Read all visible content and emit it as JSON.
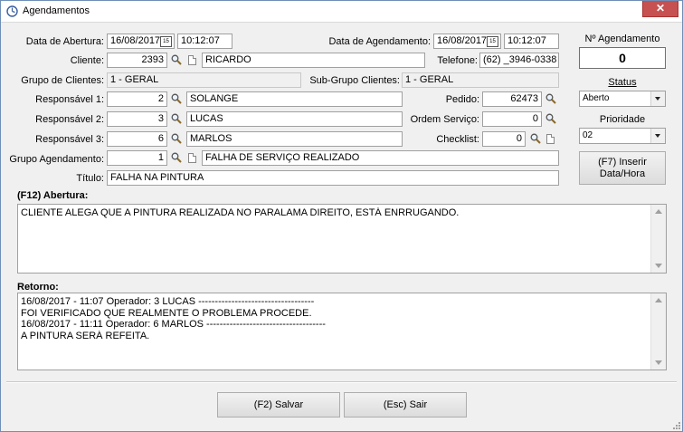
{
  "window": {
    "title": "Agendamentos",
    "close": "✕"
  },
  "form": {
    "data_abertura": {
      "label": "Data de Abertura:",
      "date": "16/08/2017",
      "time": "10:12:07"
    },
    "data_agendamento": {
      "label": "Data de Agendamento:",
      "date": "16/08/2017",
      "time": "10:12:07"
    },
    "cliente": {
      "label": "Cliente:",
      "code": "2393",
      "name": "RICARDO"
    },
    "telefone": {
      "label": "Telefone:",
      "value": "(62) _3946-0338"
    },
    "grupo_clientes": {
      "label": "Grupo de Clientes:",
      "value": "1 - GERAL"
    },
    "sub_grupo": {
      "label": "Sub-Grupo Clientes:",
      "value": "1 - GERAL"
    },
    "responsavel1": {
      "label": "Responsável 1:",
      "code": "2",
      "name": "SOLANGE"
    },
    "responsavel2": {
      "label": "Responsável 2:",
      "code": "3",
      "name": "LUCAS"
    },
    "responsavel3": {
      "label": "Responsável 3:",
      "code": "6",
      "name": "MARLOS"
    },
    "pedido": {
      "label": "Pedido:",
      "value": "62473"
    },
    "ordem_servico": {
      "label": "Ordem Serviço:",
      "value": "0"
    },
    "checklist": {
      "label": "Checklist:",
      "value": "0"
    },
    "grupo_agendamento": {
      "label": "Grupo Agendamento:",
      "code": "1",
      "name": "FALHA DE SERVIÇO REALIZADO"
    },
    "titulo": {
      "label": "Título:",
      "value": "FALHA NA PINTURA"
    }
  },
  "abertura": {
    "label": "(F12) Abertura:",
    "lines": [
      "CLIENTE ALEGA QUE A PINTURA REALIZADA NO PARALAMA DIREITO, ESTÁ ENRRUGANDO."
    ]
  },
  "retorno": {
    "label": "Retorno:",
    "lines": [
      "16/08/2017 - 11:07 Operador: 3 LUCAS -----------------------------------",
      "FOI VERIFICADO QUE REALMENTE O PROBLEMA PROCEDE.",
      "16/08/2017 - 11:11 Operador: 6 MARLOS ------------------------------------",
      "A PINTURA SERÁ REFEITA."
    ]
  },
  "side": {
    "num_agendamento_label": "Nº Agendamento",
    "num_agendamento_value": "0",
    "status_label": "Status",
    "status_value": "Aberto",
    "prioridade_label": "Prioridade",
    "prioridade_value": "02",
    "inserir_line1": "(F7) Inserir",
    "inserir_line2": "Data/Hora"
  },
  "buttons": {
    "salvar": "(F2) Salvar",
    "sair": "(Esc) Sair"
  },
  "colors": {
    "close_button": "#c75050",
    "window_border": "#6f8fb8"
  }
}
